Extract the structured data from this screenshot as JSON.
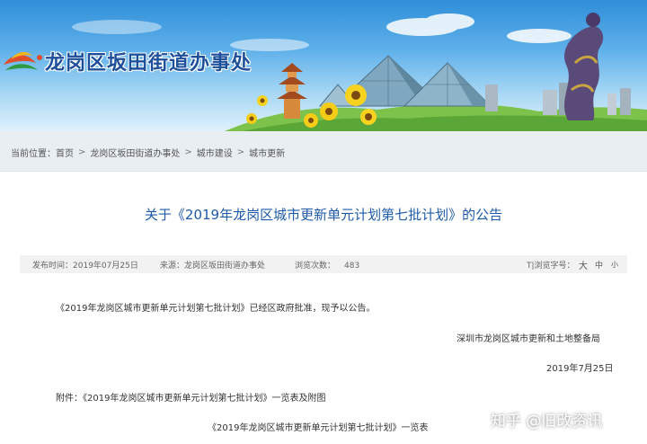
{
  "site": {
    "title": "龙岗区坂田街道办事处"
  },
  "breadcrumb": {
    "label": "当前位置：",
    "items": [
      "首页",
      "龙岗区坂田街道办事处",
      "城市建设",
      "城市更新"
    ],
    "separator": ">"
  },
  "article": {
    "title": "关于《2019年龙岗区城市更新单元计划第七批计划》的公告",
    "meta": {
      "publish_label": "发布时间：",
      "publish_date": "2019年07月25日",
      "source_label": "来源：",
      "source": "龙岗区坂田街道办事处",
      "views_label": "浏览次数：",
      "views": "483",
      "font_size_label": "T|浏览字号：",
      "font_sizes": [
        "大",
        "中",
        "小"
      ]
    },
    "paragraph": "《2019年龙岗区城市更新单元计划第七批计划》已经区政府批准，现予以公告。",
    "issuer": "深圳市龙岗区城市更新和土地整备局",
    "date": "2019年7月25日",
    "attachment": "附件：《2019年龙岗区城市更新单元计划第七批计划》一览表及附图",
    "table_caption": "《2019年龙岗区城市更新单元计划第七批计划》一览表"
  },
  "watermark": "知乎 @旧改资讯",
  "colors": {
    "title_blue": "#1f5ba8",
    "site_title": "#1d4f9a",
    "sky_top": "#2f8fd8",
    "breadcrumb_bg": "#e9eef3"
  }
}
